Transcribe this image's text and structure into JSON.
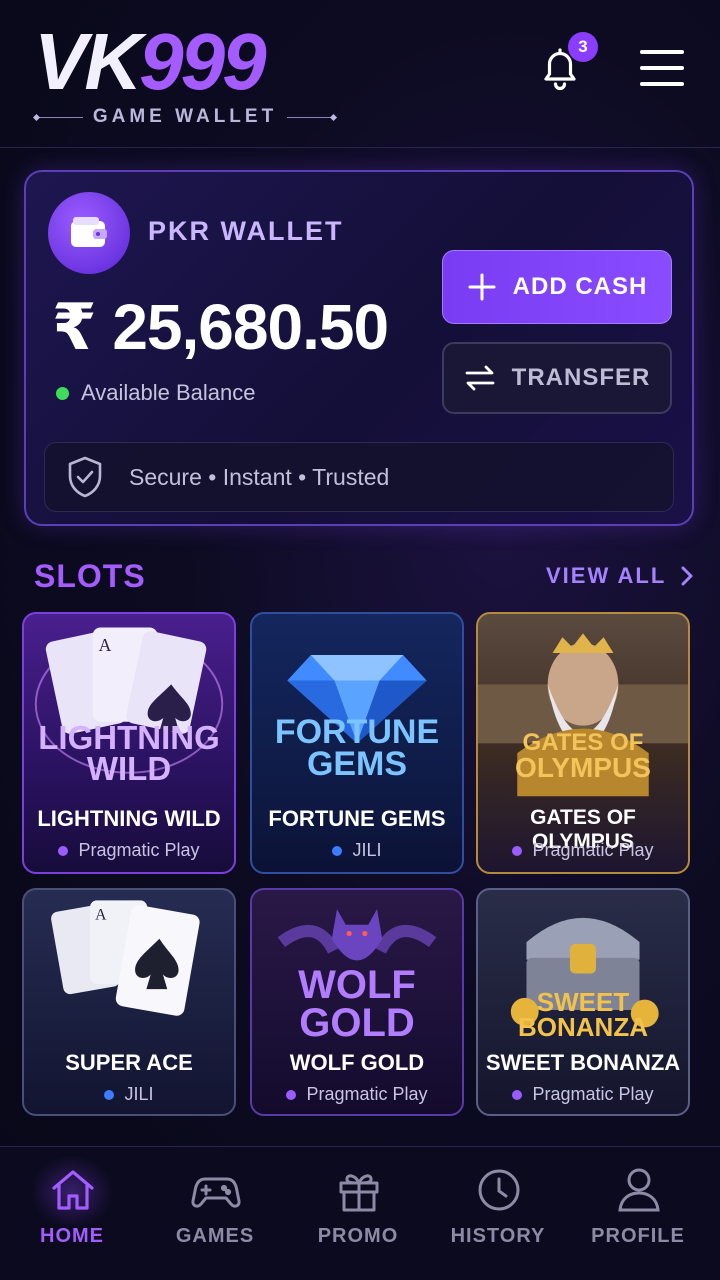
{
  "header": {
    "logo_vk": "VK",
    "logo_num": "999",
    "tagline": "GAME WALLET",
    "notification_count": "3"
  },
  "wallet": {
    "title": "PKR WALLET",
    "balance": "₹ 25,680.50",
    "available_label": "Available Balance",
    "add_cash_label": "ADD CASH",
    "transfer_label": "TRANSFER",
    "secure_text": "Secure • Instant • Trusted"
  },
  "slots": {
    "title": "SLOTS",
    "view_all": "VIEW ALL",
    "games": [
      {
        "name": "LIGHTNING WILD",
        "art_line1": "LIGHTNING",
        "art_line2": "WILD",
        "provider": "Pragmatic Play",
        "provider_color": "#9b5cff"
      },
      {
        "name": "FORTUNE GEMS",
        "art_line1": "FORTUNE",
        "art_line2": "GEMS",
        "provider": "JILI",
        "provider_color": "#3d7bff"
      },
      {
        "name": "GATES OF OLYMPUS",
        "art_line1": "GATES OF",
        "art_line2": "OLYMPUS",
        "provider": "Pragmatic Play",
        "provider_color": "#9b5cff"
      },
      {
        "name": "SUPER ACE",
        "provider": "JILI",
        "provider_color": "#3d7bff"
      },
      {
        "name": "WOLF GOLD",
        "art_line1": "WOLF",
        "art_line2": "GOLD",
        "provider": "Pragmatic Play",
        "provider_color": "#9b5cff"
      },
      {
        "name": "SWEET BONANZA",
        "art_line1": "SWEET",
        "art_line2": "BONANZA",
        "provider": "Pragmatic Play",
        "provider_color": "#9b5cff"
      }
    ]
  },
  "nav": {
    "items": [
      {
        "label": "HOME",
        "icon": "home-icon"
      },
      {
        "label": "GAMES",
        "icon": "gamepad-icon"
      },
      {
        "label": "PROMO",
        "icon": "gift-icon"
      },
      {
        "label": "HISTORY",
        "icon": "clock-icon"
      },
      {
        "label": "PROFILE",
        "icon": "user-icon"
      }
    ],
    "active": "HOME"
  },
  "colors": {
    "accent": "#a45cff",
    "background": "#0d0b22",
    "success": "#3ddc5a"
  }
}
